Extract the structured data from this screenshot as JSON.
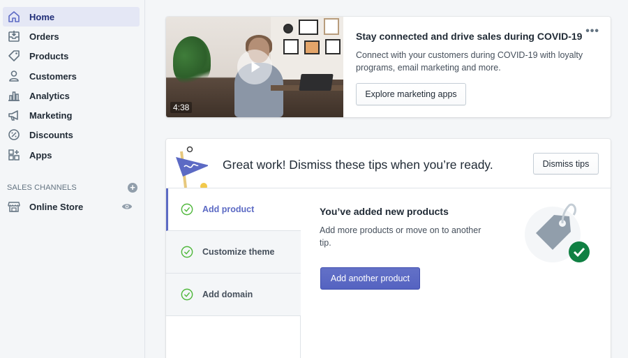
{
  "sidebar": {
    "items": [
      {
        "label": "Home",
        "icon": "home-icon",
        "active": true
      },
      {
        "label": "Orders",
        "icon": "orders-icon"
      },
      {
        "label": "Products",
        "icon": "tag-icon"
      },
      {
        "label": "Customers",
        "icon": "person-icon"
      },
      {
        "label": "Analytics",
        "icon": "bar-chart-icon"
      },
      {
        "label": "Marketing",
        "icon": "megaphone-icon"
      },
      {
        "label": "Discounts",
        "icon": "discount-icon"
      },
      {
        "label": "Apps",
        "icon": "apps-icon"
      }
    ],
    "sales_channels_label": "SALES CHANNELS",
    "online_store_label": "Online Store"
  },
  "video_card": {
    "duration": "4:38",
    "title": "Stay connected and drive sales during COVID-19",
    "description": "Connect with your customers during COVID-19 with loyalty programs, email marketing and more.",
    "button_label": "Explore marketing apps",
    "more_label": "•••"
  },
  "tips_card": {
    "heading": "Great work! Dismiss these tips when you’re ready.",
    "dismiss_label": "Dismiss tips",
    "tips": [
      {
        "label": "Add product",
        "active": true
      },
      {
        "label": "Customize theme"
      },
      {
        "label": "Add domain"
      }
    ],
    "active_tip": {
      "title": "You’ve added new products",
      "description": "Add more products or move on to another tip.",
      "button_label": "Add another product"
    }
  },
  "colors": {
    "accent": "#5c6ac4",
    "success": "#108043",
    "sidebar_active_bg": "#e4e7f5"
  }
}
